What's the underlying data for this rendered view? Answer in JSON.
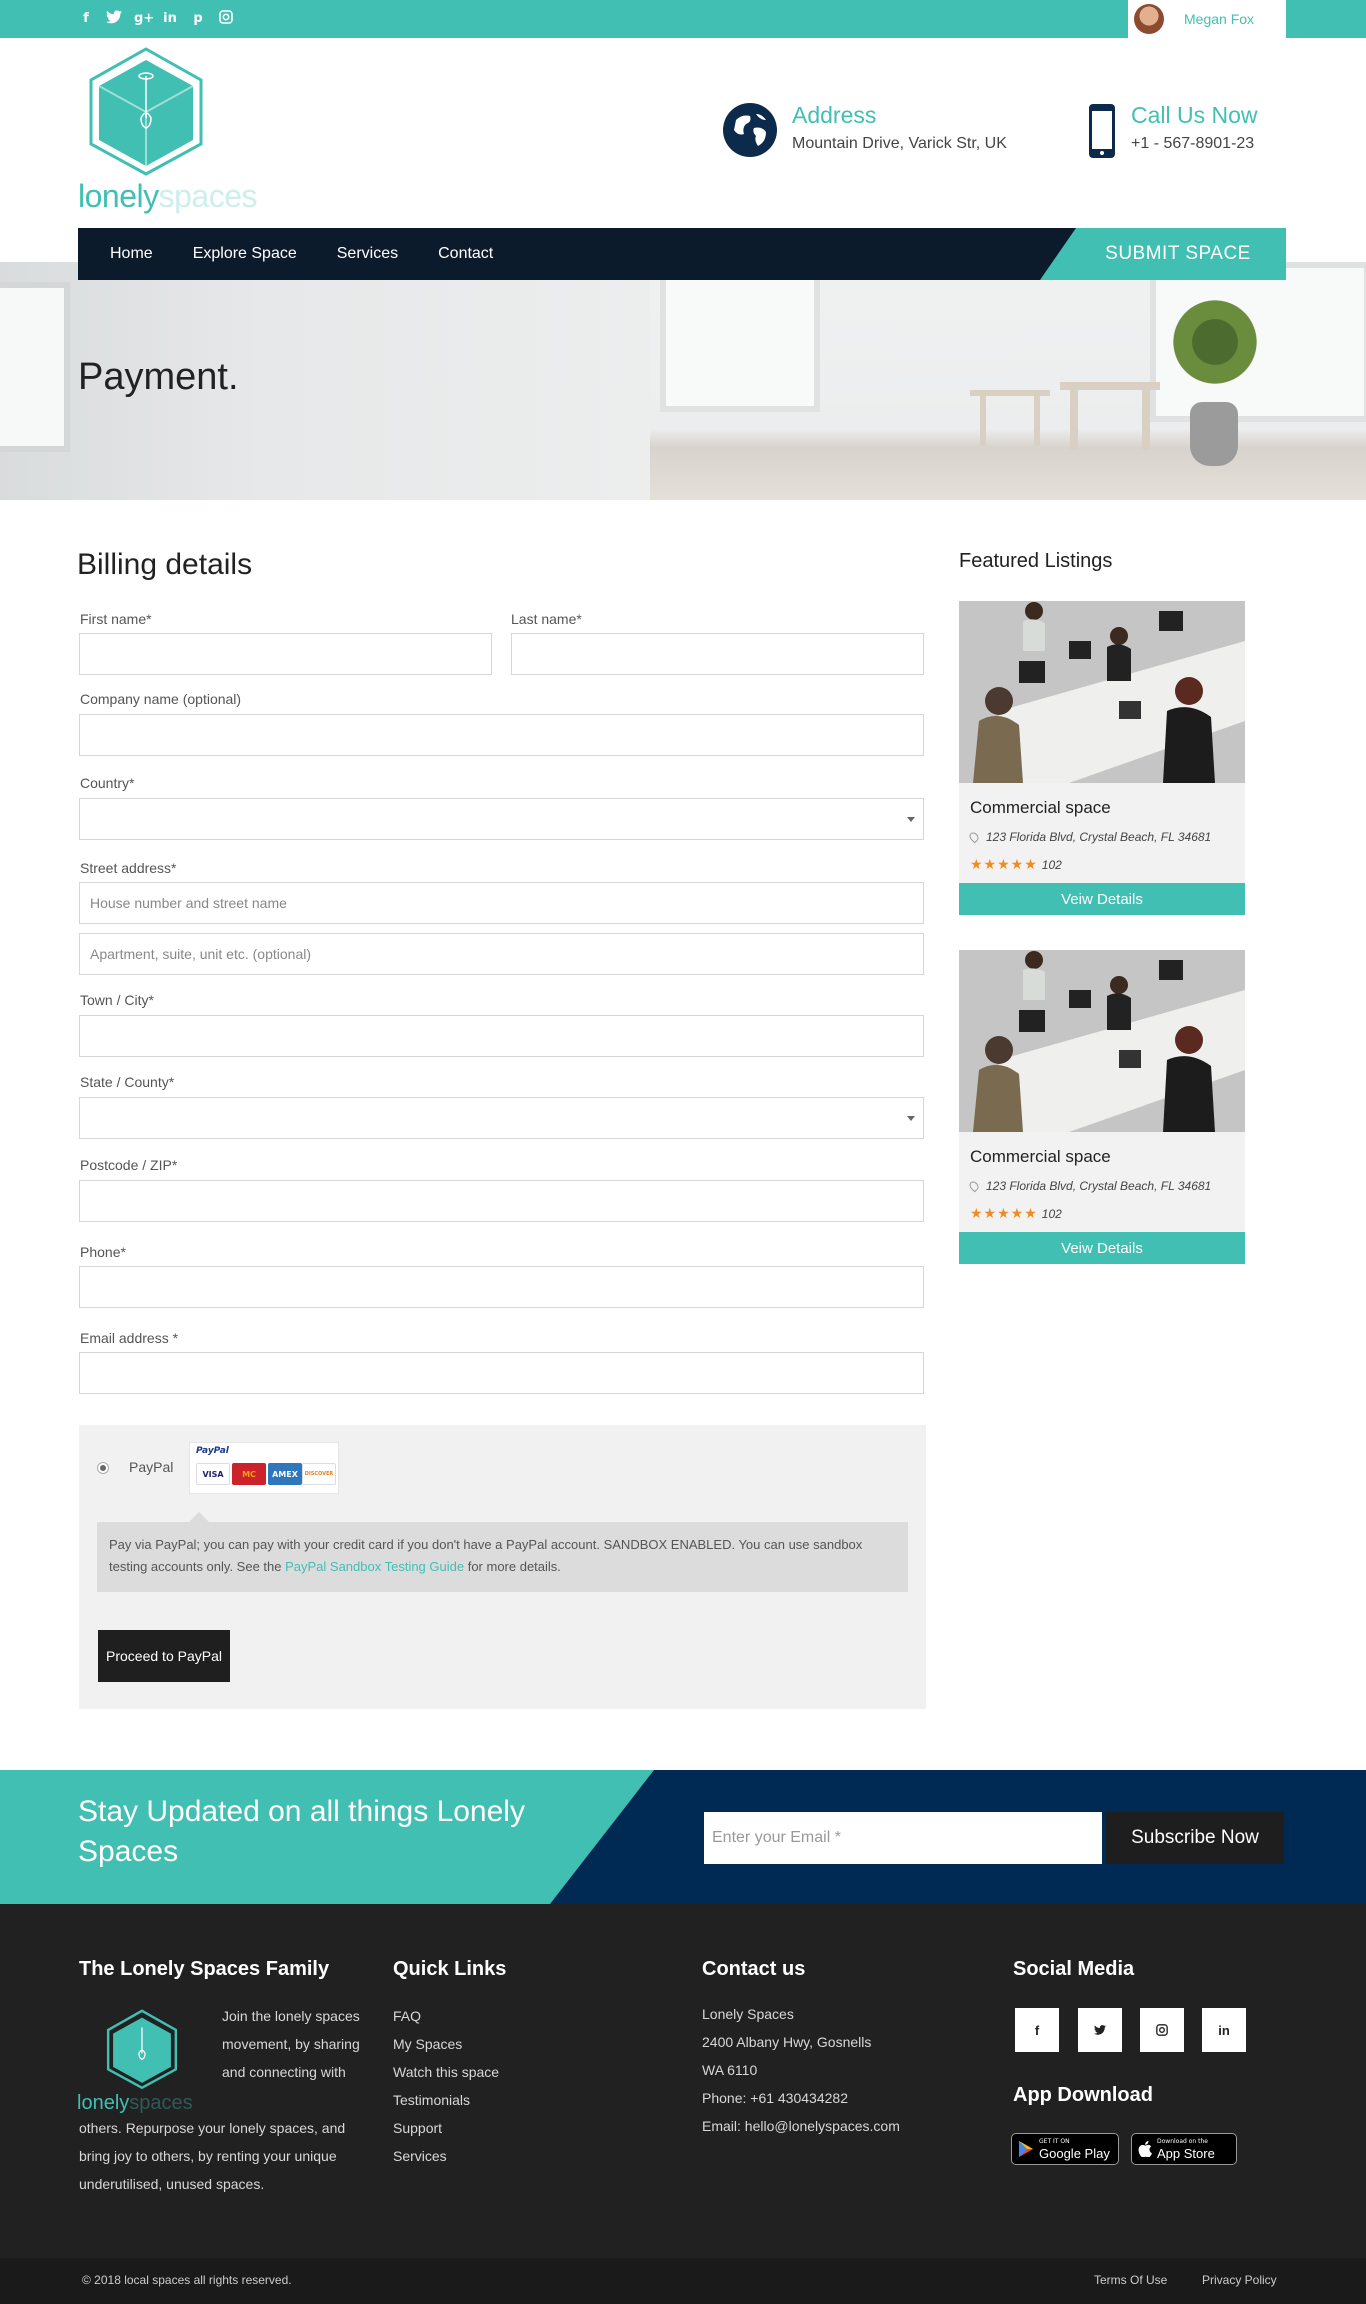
{
  "top_bar": {
    "user_name": "Megan Fox",
    "social_icons": [
      "f",
      "t",
      "g+",
      "in",
      "p",
      "ig"
    ]
  },
  "header": {
    "logo": {
      "part1": "lonely",
      "part2": "spaces"
    },
    "address": {
      "title": "Address",
      "value": "Mountain Drive, Varick Str, UK"
    },
    "call": {
      "title": "Call Us Now",
      "value": "+1 - 567-8901-23"
    }
  },
  "nav": {
    "items": [
      "Home",
      "Explore Space",
      "Services",
      "Contact"
    ],
    "submit": "SUBMIT SPACE"
  },
  "hero": {
    "title": "Payment."
  },
  "billing": {
    "title": "Billing details",
    "first_name": "First name*",
    "last_name": "Last name*",
    "company": "Company name (optional)",
    "country": "Country*",
    "street": "Street address*",
    "street_placeholder_1": "House number and street name",
    "street_placeholder_2": "Apartment, suite, unit etc. (optional)",
    "city": "Town / City*",
    "state": "State / County*",
    "postcode": "Postcode / ZIP*",
    "phone": "Phone*",
    "email": "Email address *"
  },
  "payment": {
    "method": "PayPal",
    "paypal_logo_text": "PayPal",
    "cards": [
      "VISA",
      "MC",
      "AMEX",
      "DISCOVER"
    ],
    "desc_before": "Pay via PayPal; you can pay with your credit card if you don't have a PayPal account. SANDBOX ENABLED. You can use sandbox testing accounts only. See the ",
    "desc_link": "PayPal Sandbox Testing Guide",
    "desc_after": " for more details.",
    "proceed": "Proceed to PayPal"
  },
  "featured": {
    "title": "Featured Listings",
    "listings": [
      {
        "title": "Commercial space",
        "address": "123 Florida Blvd, Crystal Beach, FL 34681",
        "stars": "★★★★★",
        "count": "102",
        "button": "Veiw Details"
      },
      {
        "title": "Commercial space",
        "address": "123 Florida Blvd, Crystal Beach, FL 34681",
        "stars": "★★★★★",
        "count": "102",
        "button": "Veiw Details"
      }
    ]
  },
  "newsletter": {
    "title": "Stay Updated on all things Lonely Spaces",
    "placeholder": "Enter your Email *",
    "button": "Subscribe Now"
  },
  "footer": {
    "family": {
      "title": "The Lonely Spaces Family",
      "para1": "Join the lonely spaces movement, by sharing and connecting with",
      "para2": "others. Repurpose your lonely spaces, and bring joy to others, by renting your unique underutilised, unused spaces."
    },
    "quick_links": {
      "title": "Quick Links",
      "items": [
        "FAQ",
        "My Spaces",
        "Watch this space",
        "Testimonials",
        "Support",
        "Services"
      ]
    },
    "contact": {
      "title": "Contact us",
      "lines": [
        "Lonely Spaces",
        "2400 Albany Hwy, Gosnells",
        "WA 6110",
        "Phone: +61 430434282",
        "Email: hello@lonelyspaces.com"
      ]
    },
    "social": {
      "title": "Social Media",
      "icons": [
        "f",
        "t",
        "ig",
        "in"
      ],
      "app_title": "App Download",
      "google": {
        "small": "GET IT ON",
        "big": "Google Play"
      },
      "apple": {
        "small": "Download on the",
        "big": "App Store"
      }
    },
    "copyright": "© 2018 local spaces all rights reserved.",
    "terms": "Terms Of Use",
    "privacy": "Privacy Policy"
  },
  "colors": {
    "accent": "#41bfb3",
    "navy": "#0c1b2c",
    "dark": "#212121"
  }
}
